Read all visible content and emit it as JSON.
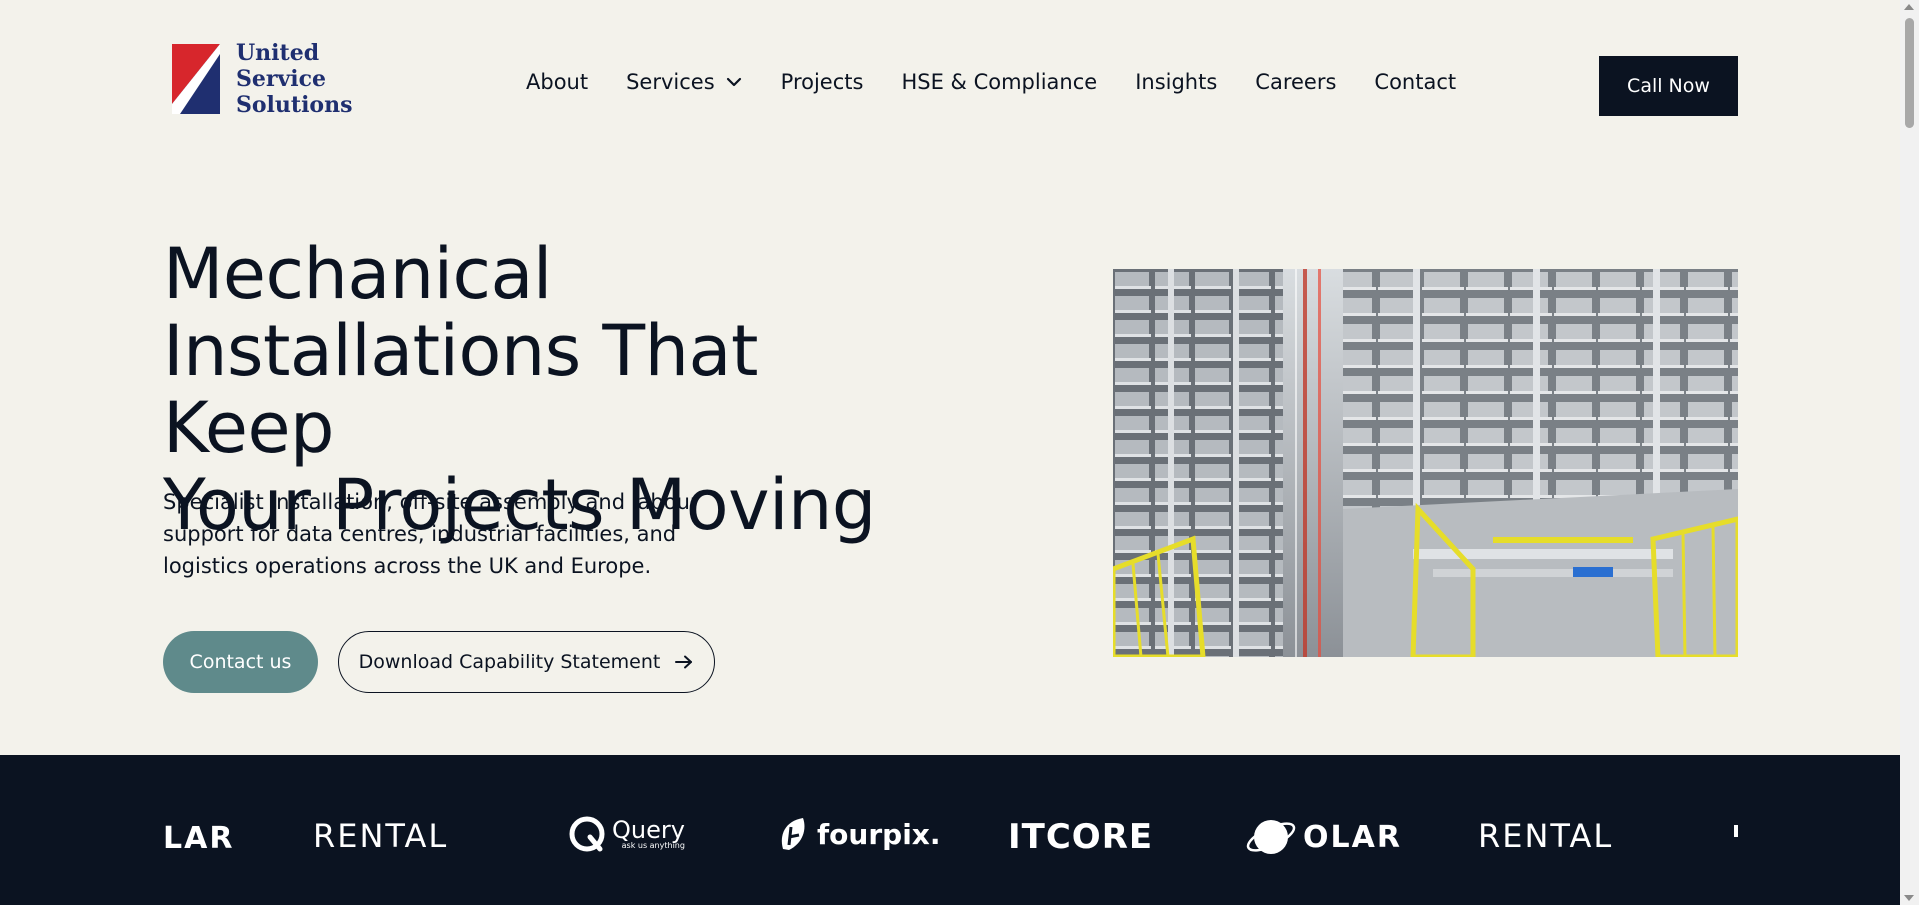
{
  "header": {
    "logo": {
      "lines": [
        "United",
        "Service",
        "Solutions"
      ]
    },
    "nav": [
      {
        "label": "About"
      },
      {
        "label": "Services",
        "has_dropdown": true
      },
      {
        "label": "Projects"
      },
      {
        "label": "HSE & Compliance"
      },
      {
        "label": "Insights"
      },
      {
        "label": "Careers"
      },
      {
        "label": "Contact"
      }
    ],
    "cta_label": "Call Now"
  },
  "hero": {
    "title_lines": [
      "Mechanical",
      "Installations That Keep",
      "Your Projects Moving"
    ],
    "description": "Specialist installation, off-site assembly and labour support for data centres, industrial facilities, and logistics operations across the UK and Europe.",
    "primary_button": "Contact us",
    "secondary_button": "Download Capability Statement",
    "image_icon": "automated-warehouse-photo"
  },
  "logo_strip": {
    "brands": [
      {
        "name": "LAR"
      },
      {
        "name": "RENTAL"
      },
      {
        "name": "Query",
        "tagline": "ask us anything"
      },
      {
        "name": "fourpix."
      },
      {
        "name": "ITCORE"
      },
      {
        "name": "OLAR"
      },
      {
        "name": "RENTAL"
      }
    ]
  },
  "colors": {
    "background": "#f3f2eb",
    "navy": "#0b1321",
    "logo_blue": "#1f2f70",
    "logo_red": "#d7262c",
    "teal_button": "#5f8a8b"
  }
}
